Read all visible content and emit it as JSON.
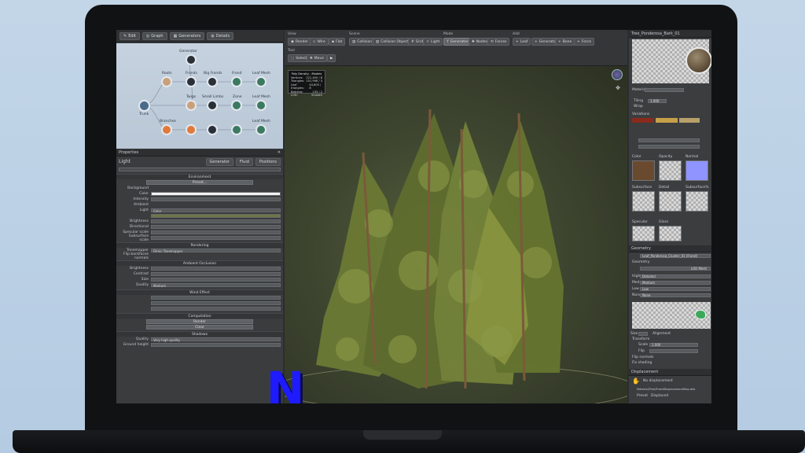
{
  "left_toolbar": [
    "Edit",
    "Graph",
    "Generators",
    "Details"
  ],
  "graph": {
    "nodes": [
      {
        "label": "Trunk",
        "color": "#4a6a8a"
      },
      {
        "label": "Roots",
        "color": "#c9a07a"
      },
      {
        "label": "Fronds",
        "color": "#2a3038"
      },
      {
        "label": "Big Fronds",
        "color": "#2a3038"
      },
      {
        "label": "Frond",
        "color": "#3b7a60"
      },
      {
        "label": "Leaf Mesh",
        "color": "#3b7a60"
      },
      {
        "label": "Twigs",
        "color": "#c9a07a"
      },
      {
        "label": "Small Limbs",
        "color": "#2a3038"
      },
      {
        "label": "Zone",
        "color": "#3b7a60"
      },
      {
        "label": "Leaf Mesh",
        "color": "#3b7a60"
      },
      {
        "label": "Branches",
        "color": "#e07a3a"
      },
      {
        "label": "Leaf Mesh",
        "color": "#3b7a60"
      }
    ],
    "top_node": "Generator"
  },
  "properties": {
    "title": "Properties",
    "object_label": "Light",
    "tabs": [
      "Generator",
      "Fluid",
      "Positions"
    ],
    "sections": {
      "environment": "Environment",
      "rendering": "Rendering",
      "ambient_occlusion": "Ambient Occlusion",
      "wind": "Wind Effect",
      "computation": "Computation",
      "shadows": "Shadows"
    },
    "env_preset_btn": "Preset...",
    "fields": {
      "background": "Background",
      "color": "Color",
      "intensity": "Intensity",
      "ambient": "Ambient",
      "light": "Light",
      "light_value": "Color",
      "brightness": "Brightness",
      "directional": "Directional",
      "specular": "Specular scale",
      "subsurface": "Subsurface scale",
      "tonemapper": "Tonemapper",
      "tonemapper_value": "Filmic Tonemapper",
      "fliptbnormals": "Flip backfaces normals",
      "brightness2": "Brightness",
      "contrast": "Contrast",
      "size": "Size",
      "quality": "Quality",
      "quality_value": "Medium",
      "render_btn": "Render",
      "clear_btn": "Clear",
      "shadows_quality": "Quality",
      "shadows_quality_value": "Very high quality",
      "shadow_height": "Ground height"
    }
  },
  "viewport": {
    "groups": [
      "View",
      "Scene",
      "Mode",
      "Add"
    ],
    "view_buttons": [
      "Render",
      "Wire",
      "Flat"
    ],
    "scene_buttons": [
      "Collision",
      "Collision Objects",
      "Grid",
      "Light"
    ],
    "mode_buttons": [
      "Generators",
      "Nodes",
      "Forces"
    ],
    "add_buttons": [
      "Leaf",
      "Generator",
      "Bone",
      "Force"
    ],
    "sub_group": "Tool",
    "sub_buttons": [
      "Select",
      "Move",
      "Play"
    ],
    "stats": {
      "title": "Poly Density - Models",
      "rows": [
        [
          "Vertices:",
          "221,405 / 8"
        ],
        [
          "Triangles:",
          "151,998 / 3"
        ],
        [
          "Leaf triangles:",
          "44,605 / 8"
        ],
        [
          "Batches:",
          "133 / 2"
        ],
        [
          "LOD:",
          "Smooth"
        ]
      ]
    }
  },
  "right_panel": {
    "material_title": "Tree_Ponderosa_Bark_01",
    "material_label": "Material",
    "variations": "Variations",
    "tiling_label": "Tiling",
    "tiling_value": "1.000",
    "wrap_label": "Wrap",
    "map_labels": [
      "Color",
      "Opacity",
      "Normal",
      "Subsurface",
      "Detail",
      "Specular",
      "Gloss",
      "Subsurface%"
    ],
    "mesh_title": "Leaf_Ponderosa_Cluster_01 (Frond)",
    "geometry_label": "Geometry",
    "lod_label": "LOD Mesh",
    "lods": [
      "High",
      "Med",
      "Low",
      "None"
    ],
    "lod_values": [
      "Detailed",
      "Medium",
      "Low",
      "None"
    ],
    "size_label": "Size",
    "alignment": "Alignment",
    "transform": "Transform",
    "scale_label": "Scale",
    "scale_value": "1.000",
    "flip_label": "Flip",
    "flip_normals": "Flip normals",
    "fix_shading": "Fix shading",
    "displacement": "Displacement",
    "no_displacement": "No displacement",
    "displacement_path": "Material/Tree/FrondDisplacementMap.dds",
    "preset_label": "Preset",
    "preset_value": "Displaced"
  },
  "colors": {
    "accent_blue": "#3a7bd5",
    "palette_red": "#8a2a1a",
    "palette_tan": "#c6a049",
    "logo_color": "#1f1bff"
  },
  "logo_text": "N"
}
